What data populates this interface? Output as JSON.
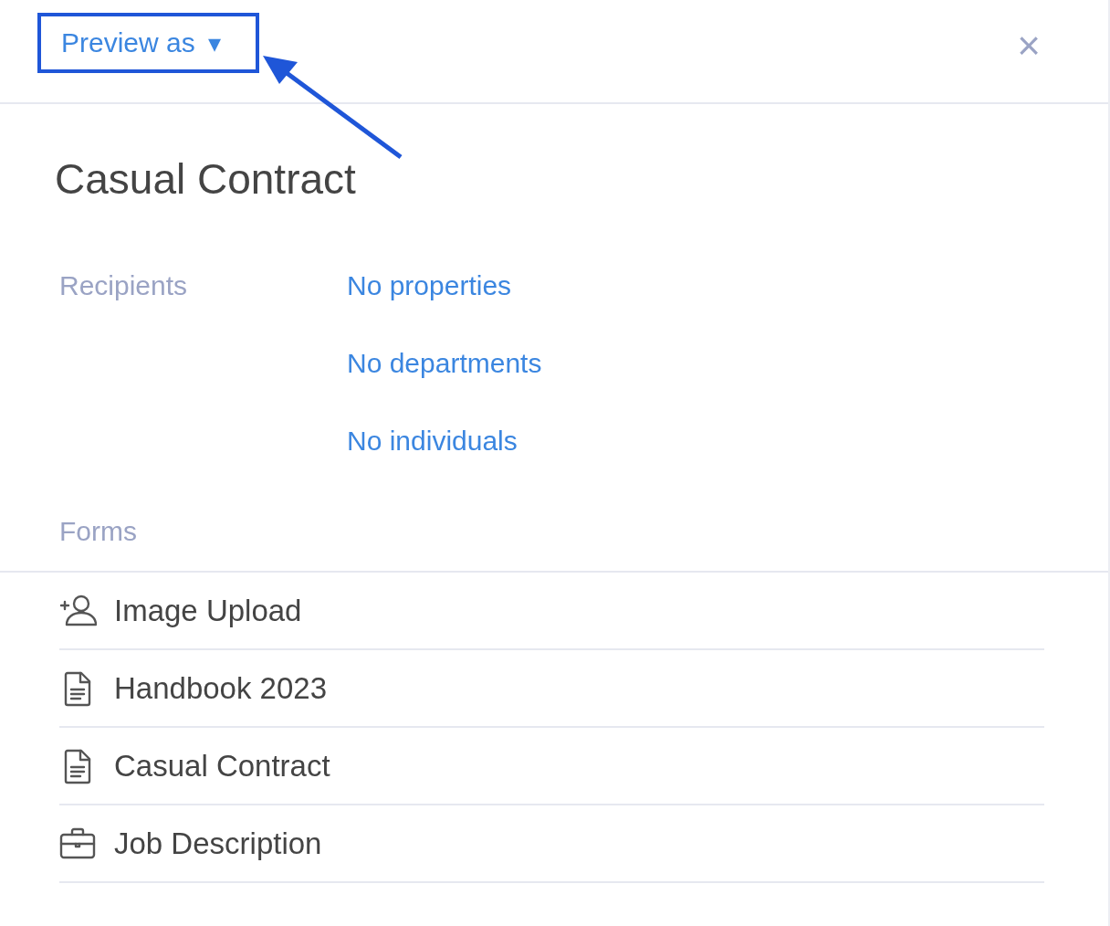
{
  "header": {
    "preview_button": {
      "label": "Preview as",
      "caret": "▾"
    },
    "close": "×"
  },
  "title": "Casual Contract",
  "recipients": {
    "label": "Recipients",
    "values": [
      "No properties",
      "No departments",
      "No individuals"
    ]
  },
  "forms": {
    "label": "Forms",
    "items": [
      {
        "kind": "person-add",
        "name": "Image Upload"
      },
      {
        "kind": "document",
        "name": "Handbook 2023"
      },
      {
        "kind": "document",
        "name": "Casual Contract"
      },
      {
        "kind": "briefcase",
        "name": "Job Description"
      }
    ]
  }
}
